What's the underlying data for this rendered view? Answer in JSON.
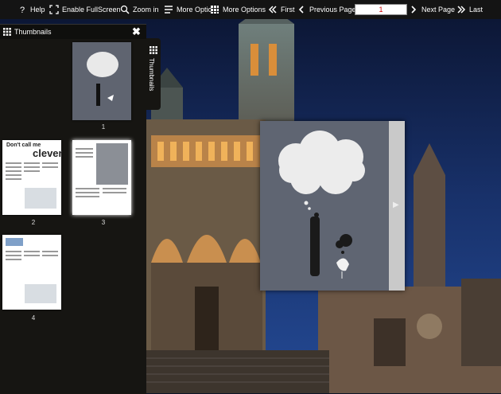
{
  "toolbar": {
    "help_label": "Help",
    "fullscreen_label": "Enable FullScreen",
    "zoom_label": "Zoom in",
    "more_options_label_1": "More Optio",
    "more_options_label_2": "More Options",
    "first_label": "First",
    "previous_label": "Previous Page",
    "page_value": "1",
    "next_label": "Next Page",
    "last_label": "Last",
    "icons": [
      "help-icon",
      "fullscreen-icon",
      "zoom-icon",
      "menu-icon",
      "grid-icon",
      "first-icon",
      "previous-icon",
      "next-icon",
      "last-icon"
    ]
  },
  "thumbnails_panel": {
    "title": "Thumbnails",
    "close_label": "✖",
    "side_tab_label": "Thumbnails",
    "items": [
      {
        "number": "1"
      },
      {
        "number": "2",
        "heading_1": "Don't call me",
        "heading_2": "clever"
      },
      {
        "number": "3"
      },
      {
        "number": "4"
      }
    ]
  },
  "colors": {
    "toolbar_bg": "#141414",
    "panel_bg": "#161512",
    "sky_top": "#0d1a3a",
    "sky_bottom": "#1f3a7a",
    "building": "#7c6b55",
    "page_input_text": "#c00000"
  },
  "book": {
    "next_arrow": "▶"
  }
}
